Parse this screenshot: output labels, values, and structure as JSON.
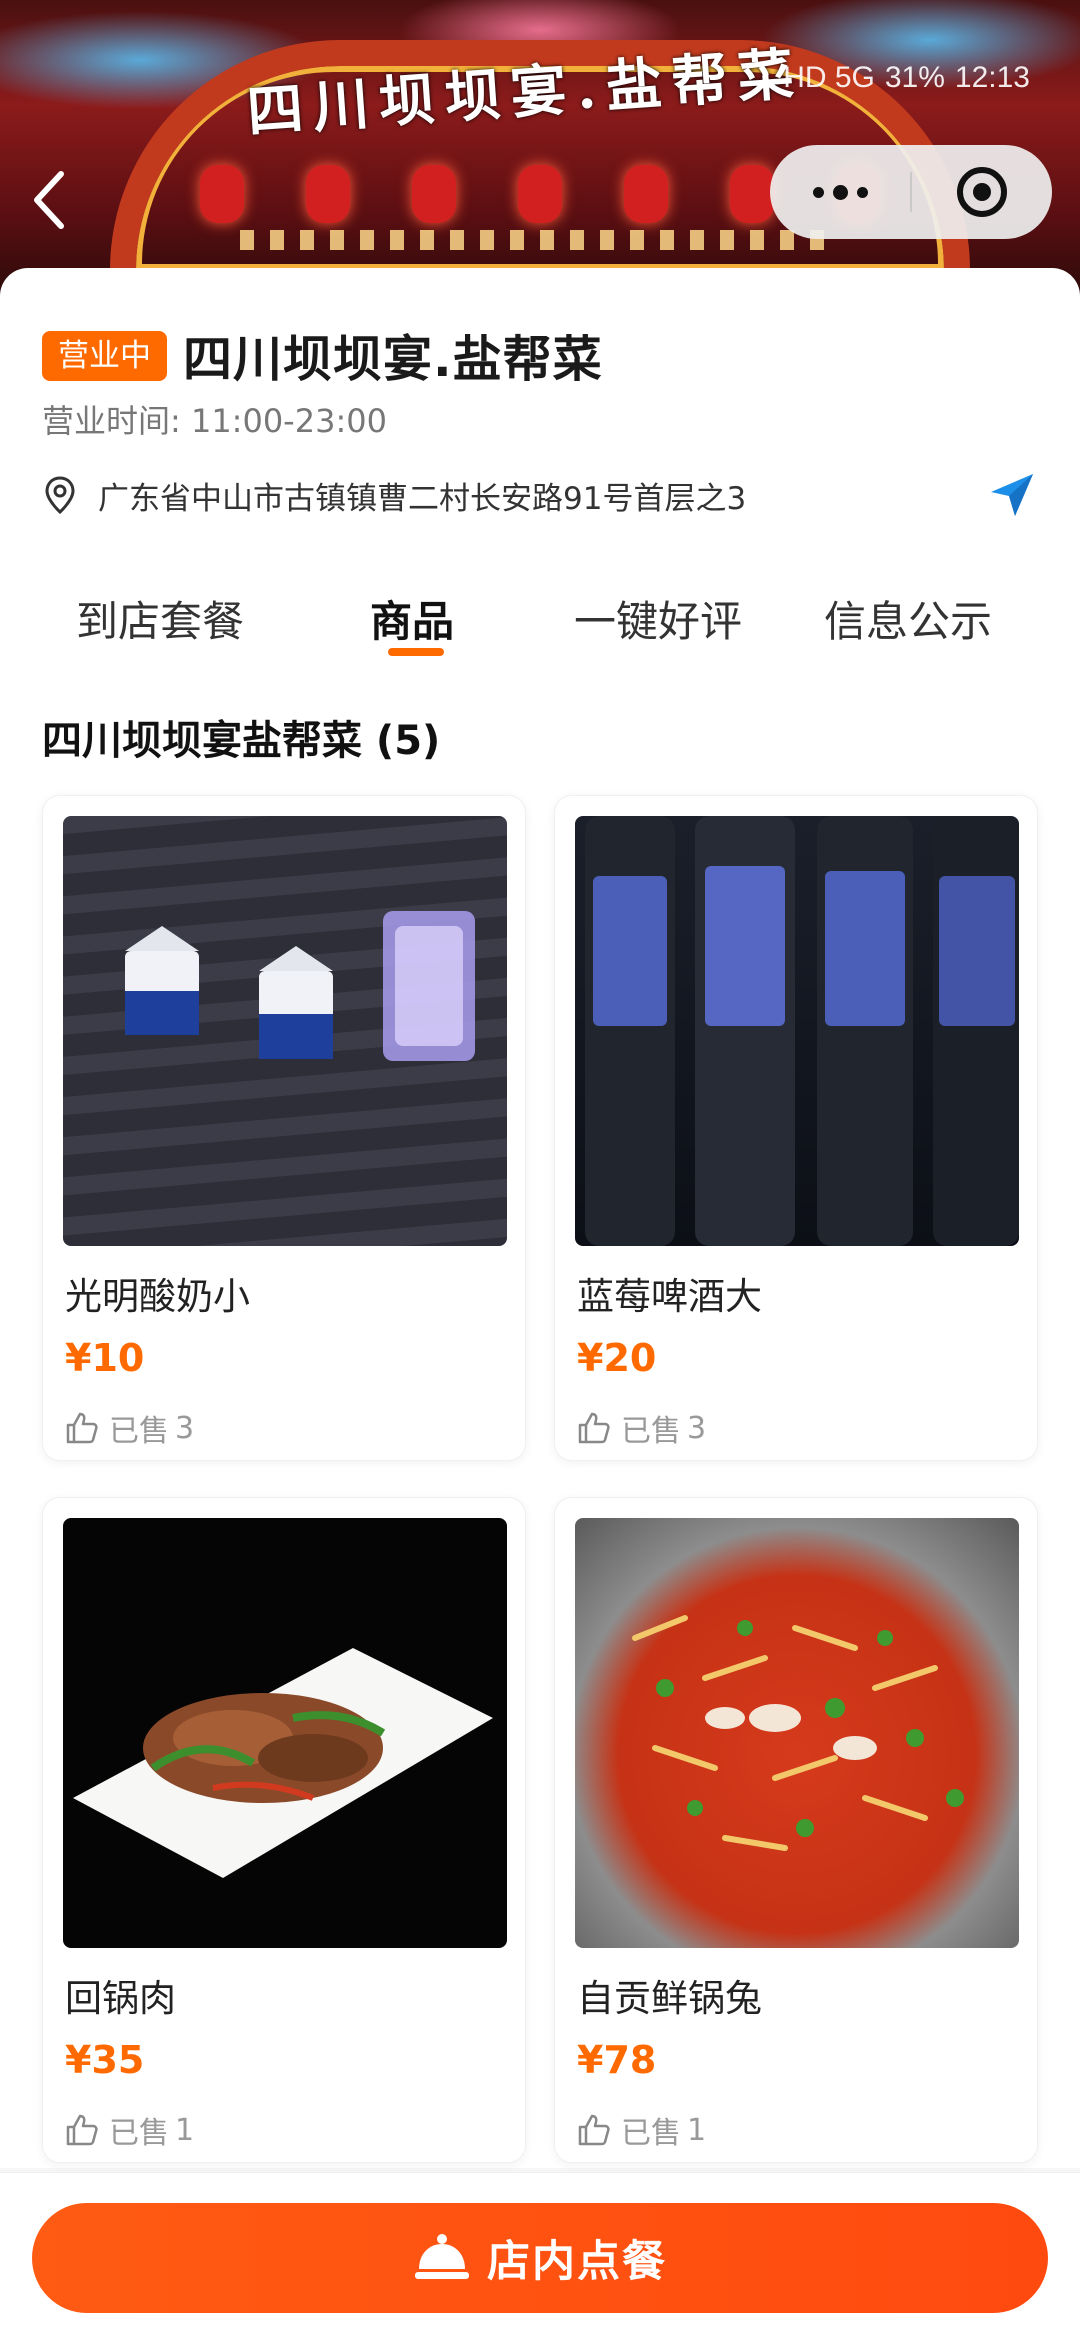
{
  "banner": {
    "sign_text": "四川坝坝宴.盐帮菜"
  },
  "statusbar": {
    "network": "HD 5G",
    "battery": "31%",
    "time": "12:13"
  },
  "store": {
    "status_tag": "营业中",
    "name": "四川坝坝宴.盐帮菜",
    "hours": "营业时间:  11:00-23:00",
    "address": "广东省中山市古镇镇曹二村长安路91号首层之3"
  },
  "tabs": [
    {
      "label": "到店套餐",
      "active": false
    },
    {
      "label": "商品",
      "active": true
    },
    {
      "label": "一键好评",
      "active": false
    },
    {
      "label": "信息公示",
      "active": false
    }
  ],
  "section": {
    "title": "四川坝坝宴盐帮菜 (5)"
  },
  "products": [
    {
      "name": "光明酸奶小",
      "price": "¥10",
      "sold_label": "已售",
      "sold_count": "3"
    },
    {
      "name": "蓝莓啤酒大",
      "price": "¥20",
      "sold_label": "已售",
      "sold_count": "3"
    },
    {
      "name": "回锅肉",
      "price": "¥35",
      "sold_label": "已售",
      "sold_count": "1"
    },
    {
      "name": "自贡鲜锅兔",
      "price": "¥78",
      "sold_label": "已售",
      "sold_count": "1"
    }
  ],
  "bottom": {
    "order_button_label": "店内点餐"
  },
  "colors": {
    "accent": "#ff6a00",
    "button": "#ff4a0f"
  }
}
